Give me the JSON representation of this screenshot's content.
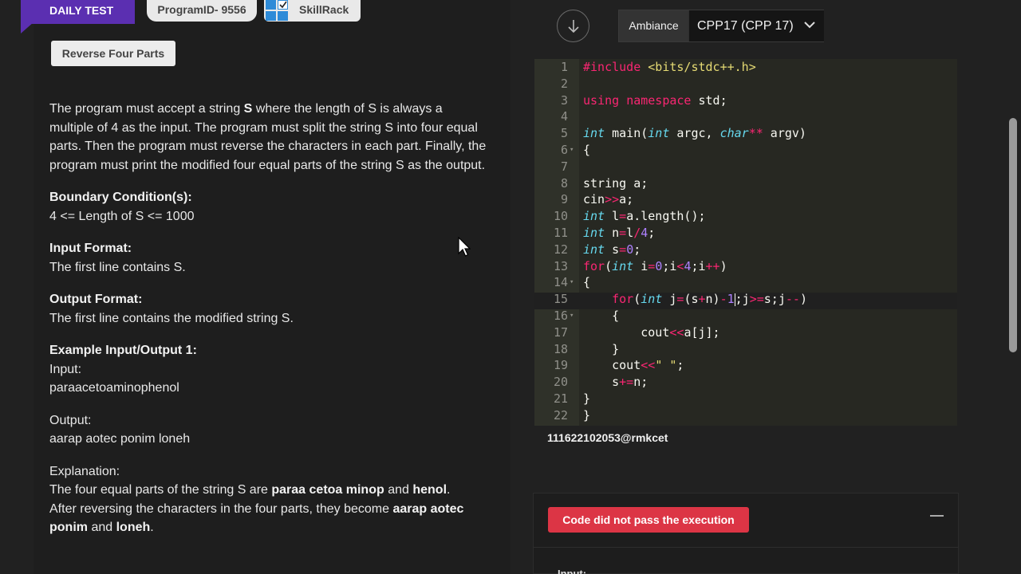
{
  "header": {
    "badge": "DAILY TEST",
    "program_id": "ProgramID- 9556",
    "brand": "SkillRack",
    "problem_title": "Reverse Four Parts"
  },
  "problem": {
    "description": {
      "part1": "The program must accept a string ",
      "highlight": "S",
      "part2": " where the length of S is always a multiple of 4 as the input. The program must split the string S into four equal parts. Then the program must reverse the characters in each part. Finally, the program must print the modified four equal parts of the string S as the output."
    },
    "boundary_title": "Boundary Condition(s):",
    "boundary_text": "4 <= Length of S <= 1000",
    "input_title": "Input Format:",
    "input_text": "The first line contains S.",
    "output_title": "Output Format:",
    "output_text": "The first line contains the modified string S.",
    "example_title": "Example Input/Output 1:",
    "example_input_label": "Input:",
    "example_input": "paraacetoaminophenol",
    "example_output_label": "Output:",
    "example_output": "aarap aotec ponim loneh",
    "explanation_label": "Explanation:",
    "explanation_1a": "The four equal parts of the string S are ",
    "explanation_1b": "paraa cetoa minop",
    "explanation_1c": " and ",
    "explanation_1d": "henol",
    "explanation_1e": ".",
    "explanation_2a": "After reversing the characters in the four parts, they become ",
    "explanation_2b": "aarap aotec ponim",
    "explanation_2c": " and ",
    "explanation_2d": "loneh",
    "explanation_2e": "."
  },
  "toolbar": {
    "download_icon": "arrow-down-icon",
    "theme_label": "Ambiance",
    "language": "CPP17 (CPP 17)"
  },
  "editor": {
    "line_numbers": [
      "1",
      "2",
      "3",
      "4",
      "5",
      "6",
      "7",
      "8",
      "9",
      "10",
      "11",
      "12",
      "13",
      "14",
      "15",
      "16",
      "17",
      "18",
      "19",
      "20",
      "21",
      "22"
    ],
    "active_line": 15,
    "colors": {
      "keyword": "#f92672",
      "type": "#66d9ef",
      "number": "#ae81ff",
      "string": "#e6db74",
      "background": "#272822"
    }
  },
  "user": {
    "id": "111622102053@rmkcet"
  },
  "result": {
    "status": "Code did not pass the execution",
    "input_label": "Input:",
    "status_color": "#dc3545"
  }
}
